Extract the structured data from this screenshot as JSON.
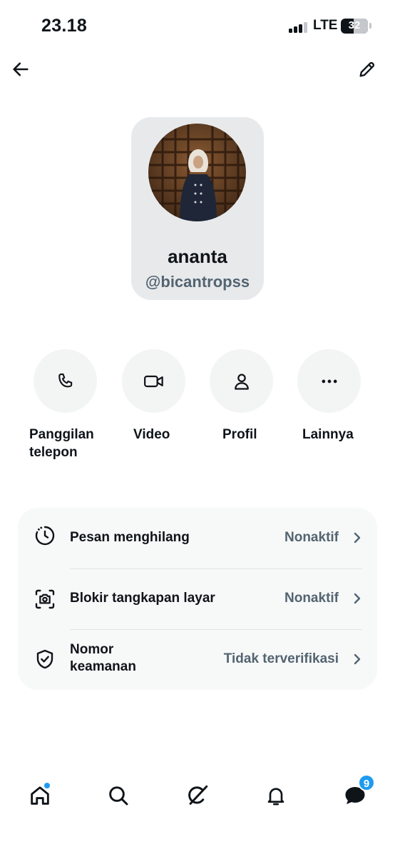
{
  "status_bar": {
    "time": "23.18",
    "network": "LTE",
    "battery": "32",
    "battery_level": 0.32
  },
  "header": {
    "back_icon": "arrow-left-icon",
    "edit_icon": "pencil-icon"
  },
  "profile": {
    "name": "ananta",
    "handle": "@bicantropss"
  },
  "actions": [
    {
      "label": "Panggilan telepon",
      "icon": "phone-icon"
    },
    {
      "label": "Video",
      "icon": "video-camera-icon"
    },
    {
      "label": "Profil",
      "icon": "person-icon"
    },
    {
      "label": "Lainnya",
      "icon": "more-dots-icon"
    }
  ],
  "settings": [
    {
      "label": "Pesan menghilang",
      "value": "Nonaktif",
      "icon": "timer-icon"
    },
    {
      "label": "Blokir tangkapan layar",
      "value": "Nonaktif",
      "icon": "screenshot-camera-icon"
    },
    {
      "label": "Nomor keamanan",
      "value": "Tidak terverifikasi",
      "icon": "shield-check-icon"
    }
  ],
  "bottom_nav": {
    "items": [
      "home-icon",
      "search-icon",
      "grok-icon",
      "bell-icon",
      "messages-icon"
    ],
    "messages_badge": "9",
    "accent_color": "#1d9bf0"
  }
}
